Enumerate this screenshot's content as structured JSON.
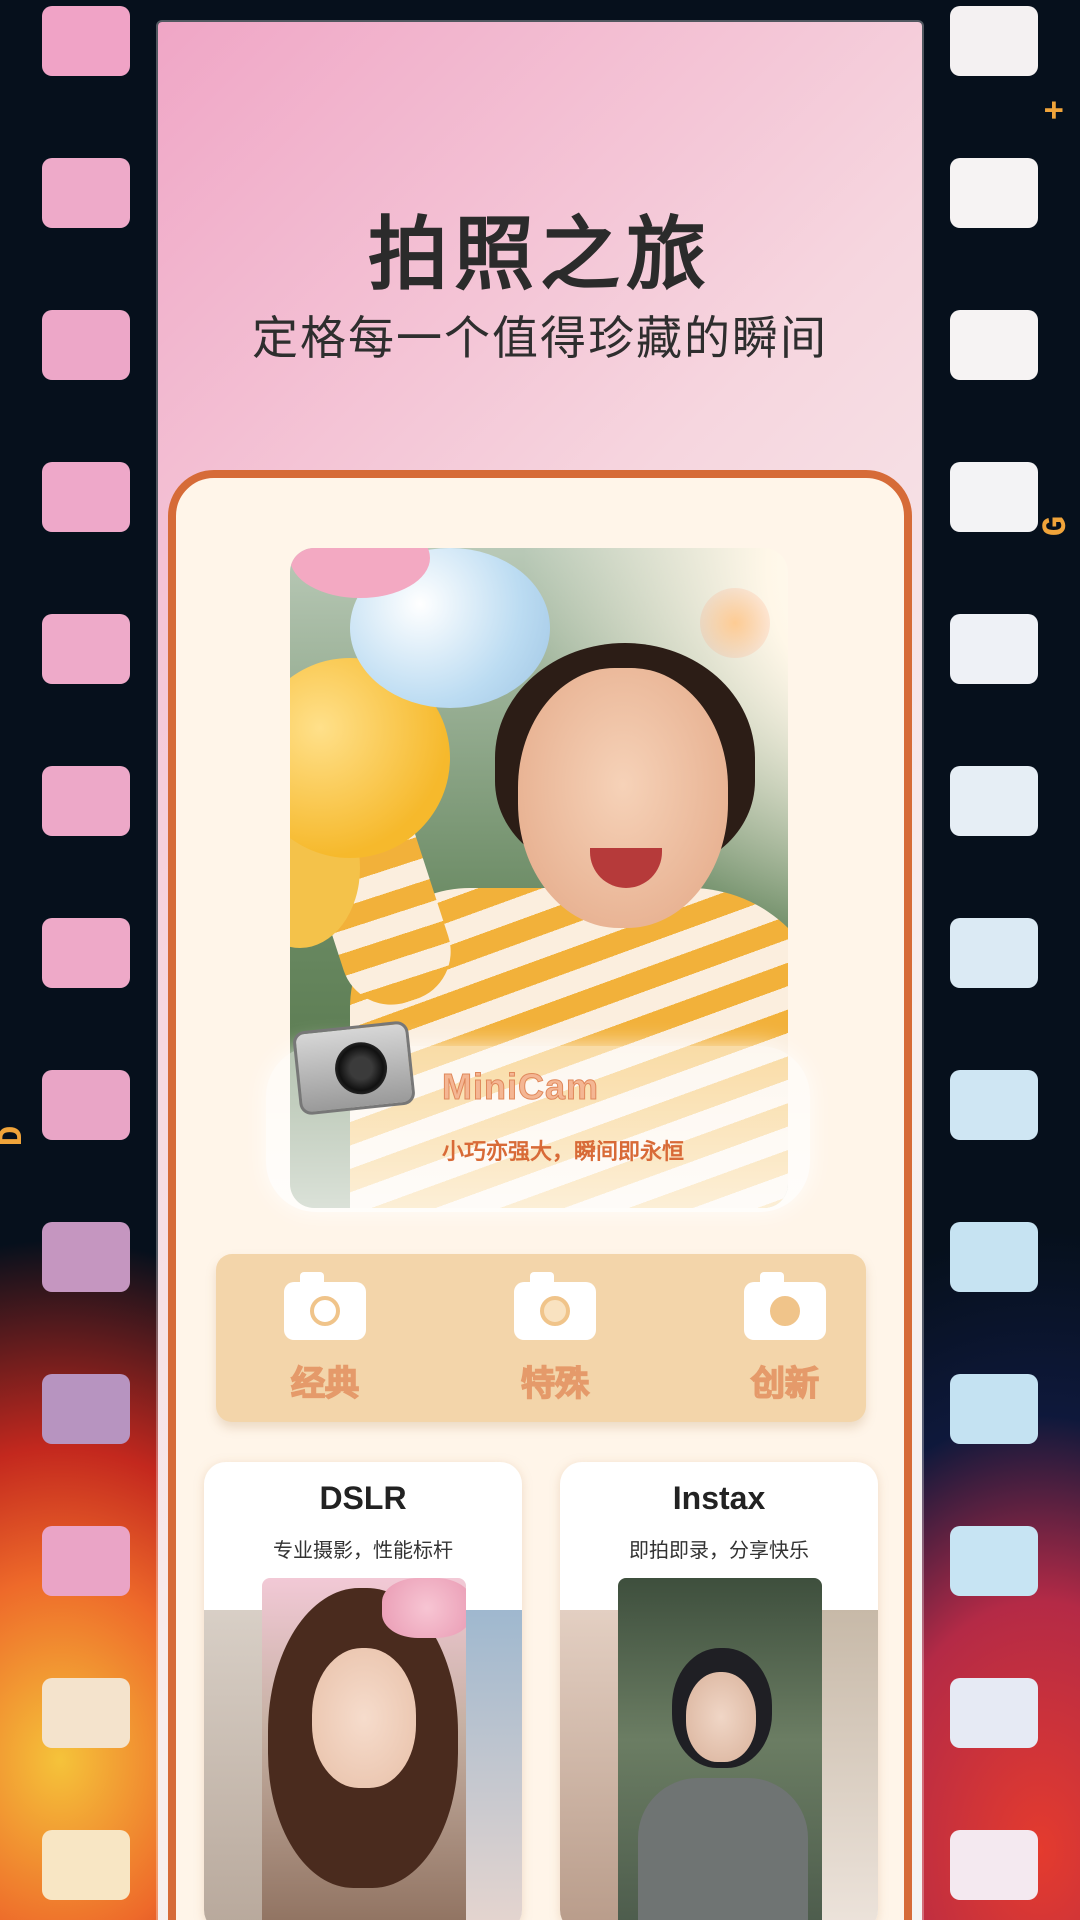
{
  "header": {
    "title": "拍照之旅",
    "subtitle": "定格每一个值得珍藏的瞬间"
  },
  "film_edge": {
    "left_mark": "D",
    "right_mark_top": "+",
    "right_mark_mid": "G"
  },
  "hero": {
    "brand": "MiniCam",
    "slogan": "小巧亦强大，瞬间即永恒"
  },
  "categories": [
    {
      "label": "经典",
      "icon": "camera-icon"
    },
    {
      "label": "特殊",
      "icon": "camera-icon"
    },
    {
      "label": "创新",
      "icon": "camera-icon"
    }
  ],
  "products": [
    {
      "title": "DSLR",
      "subtitle": "专业摄影，性能标杆"
    },
    {
      "title": "Instax",
      "subtitle": "即拍即录，分享快乐"
    }
  ],
  "colors": {
    "accent": "#d66b38",
    "card_bg": "#fff5e9",
    "category_bar": "#f3d5aa",
    "title_text": "#2b2b2b"
  }
}
